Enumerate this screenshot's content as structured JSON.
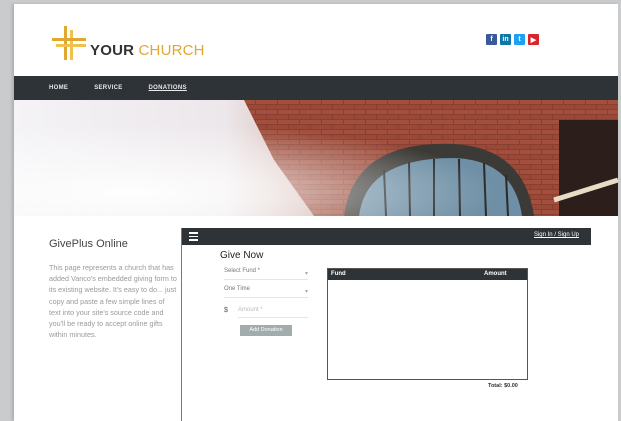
{
  "brand": {
    "your": "YOUR",
    "church": " CHURCH"
  },
  "social": [
    {
      "icon": "facebook-icon",
      "glyph": "f"
    },
    {
      "icon": "linkedin-icon",
      "glyph": "in"
    },
    {
      "icon": "twitter-icon",
      "glyph": "t"
    },
    {
      "icon": "youtube-icon",
      "glyph": "▶"
    }
  ],
  "nav": {
    "items": [
      "HOME",
      "SERVICE",
      "DONATIONS"
    ],
    "active": "DONATIONS"
  },
  "sidebar": {
    "title": "GivePlus Online",
    "text": "This page represents a church that has added Vanco's embedded giving form to its existing website. It's easy to do... just copy and paste a few simple lines of text into your site's source code and you'll be ready to accept online gifts within minutes."
  },
  "widget": {
    "signin": "Sign In / Sign Up",
    "title": "Give Now",
    "fund_select_placeholder": "Select Fund *",
    "frequency_value": "One Time",
    "currency": "$",
    "amount_placeholder": "Amount *",
    "add_button": "Add Donation",
    "table": {
      "col_fund": "Fund",
      "col_amount": "Amount"
    },
    "total": "Total: $0.00"
  },
  "colors": {
    "accent": "#e2a72e",
    "nav_bg": "#2e3338",
    "button": "#a3acad"
  }
}
